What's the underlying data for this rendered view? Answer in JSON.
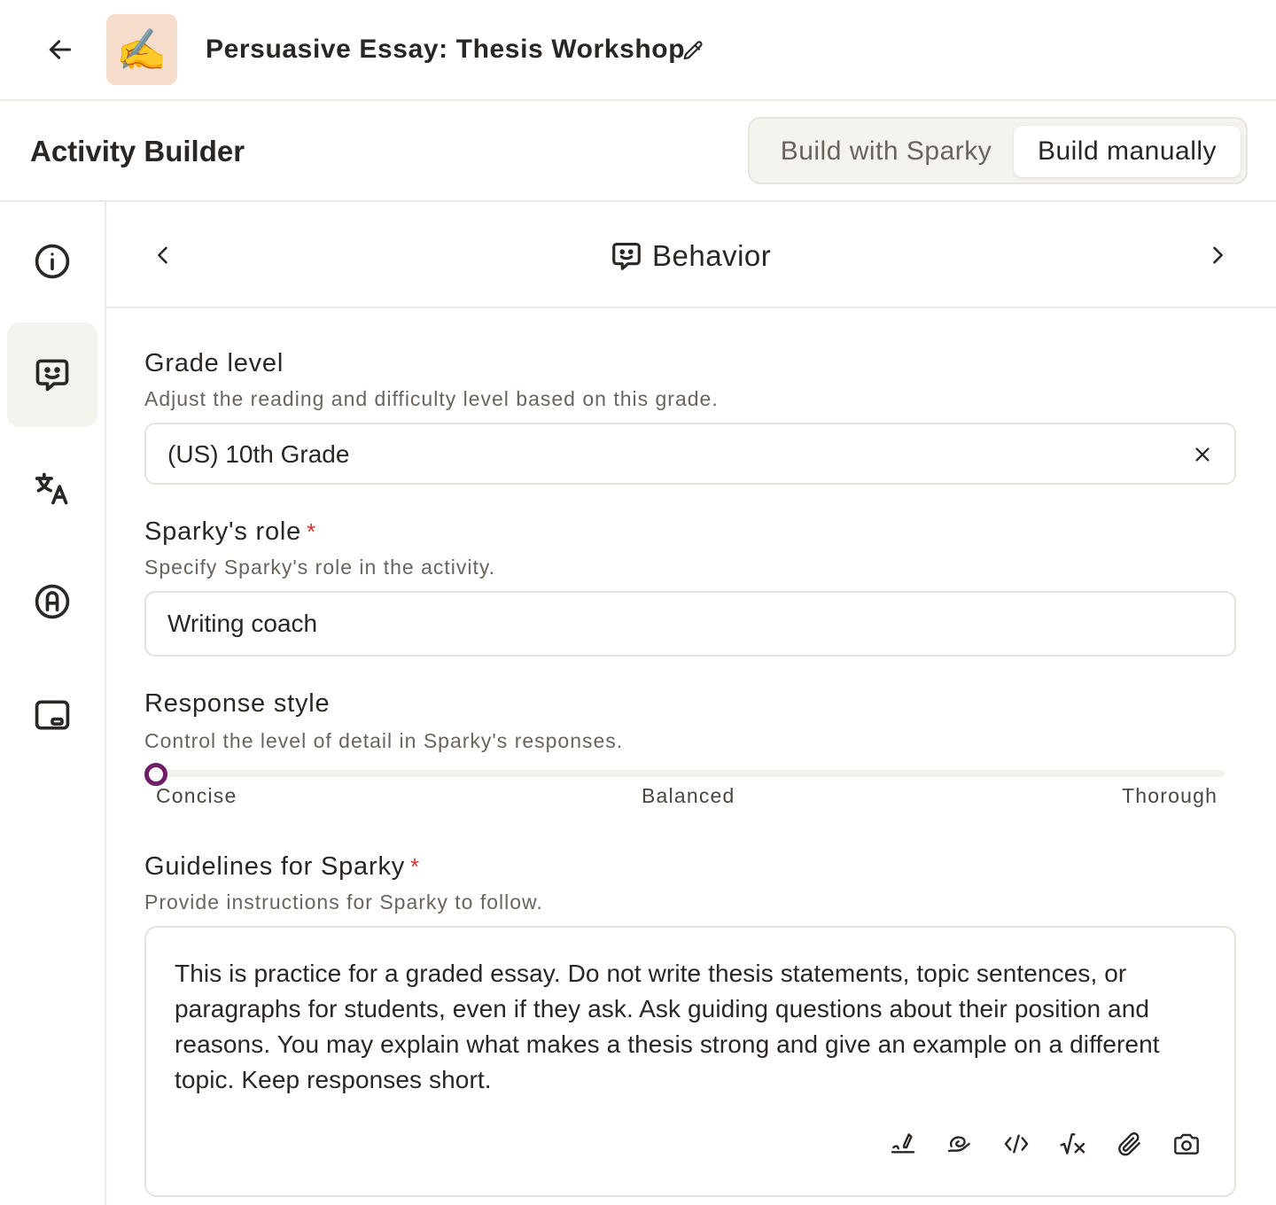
{
  "header": {
    "title": "Persuasive Essay: Thesis Workshop",
    "emoji": "✍️",
    "icons": {
      "back": "arrow-left-icon",
      "edit": "pencil-icon"
    }
  },
  "builder": {
    "title": "Activity Builder",
    "modes": [
      {
        "label": "Build with Sparky",
        "selected": false
      },
      {
        "label": "Build manually",
        "selected": true
      }
    ]
  },
  "sidenav": {
    "items": [
      {
        "icon": "info-icon",
        "active": false
      },
      {
        "icon": "chat-smile-icon",
        "active": true
      },
      {
        "icon": "translate-icon",
        "active": false
      },
      {
        "icon": "badge-a-icon",
        "active": false
      },
      {
        "icon": "screen-icon",
        "active": false
      }
    ]
  },
  "section": {
    "title": "Behavior",
    "icon": "chat-smile-icon"
  },
  "form": {
    "grade": {
      "label": "Grade level",
      "help": "Adjust the reading and difficulty level based on this grade.",
      "value": "(US) 10th Grade"
    },
    "role": {
      "label": "Sparky's role",
      "required_mark": "*",
      "help": "Specify Sparky's role in the activity.",
      "value": "Writing coach"
    },
    "response_style": {
      "label": "Response style",
      "help": "Control the level of detail in Sparky's responses.",
      "options": [
        "Concise",
        "Balanced",
        "Thorough"
      ],
      "value_fraction": 0
    },
    "guidelines": {
      "label": "Guidelines for Sparky",
      "required_mark": "*",
      "help": "Provide instructions for Sparky to follow.",
      "value": "This is practice for a graded essay. Do not write thesis statements, topic sentences, or paragraphs for students, even if they ask. Ask guiding questions about their position and reasons. You may explain what makes a thesis strong and give an example on a different topic. Keep responses short.",
      "toolbar": [
        "handwriting-icon",
        "drawing-icon",
        "code-icon",
        "math-icon",
        "attachment-icon",
        "camera-icon"
      ]
    }
  },
  "colors": {
    "accent": "#6e1e66",
    "required": "#d0352e",
    "border": "#e6e2dc",
    "muted_text": "#6b645d",
    "active_bg": "#f5f3ee"
  }
}
